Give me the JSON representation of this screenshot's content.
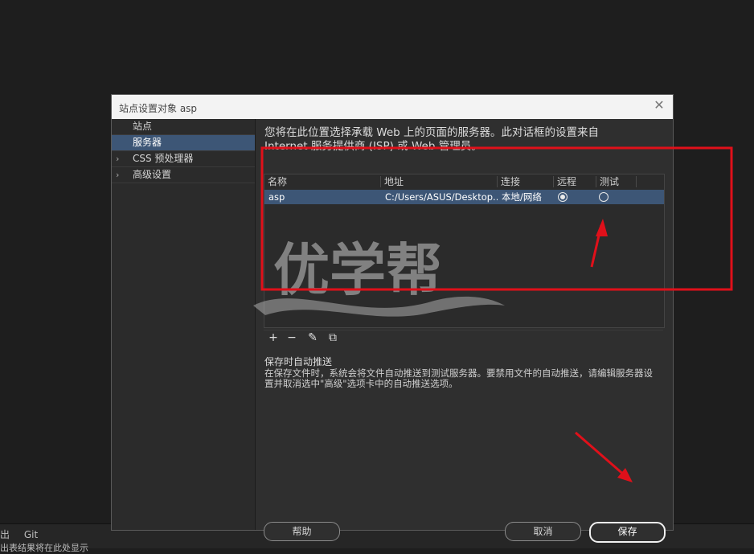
{
  "dialog": {
    "title": "站点设置对象 asp",
    "close_icon": "close-icon"
  },
  "sidebar": {
    "items": [
      {
        "label": "站点",
        "expandable": false,
        "selected": false
      },
      {
        "label": "服务器",
        "expandable": false,
        "selected": true
      },
      {
        "label": "CSS 预处理器",
        "expandable": true,
        "selected": false
      },
      {
        "label": "高级设置",
        "expandable": true,
        "selected": false
      }
    ]
  },
  "main": {
    "description": "您将在此位置选择承载 Web 上的页面的服务器。此对话框的设置来自 Internet 服务提供商 (ISP) 或 Web 管理员。",
    "table": {
      "headers": [
        "名称",
        "地址",
        "连接",
        "远程",
        "测试"
      ],
      "rows": [
        {
          "name": "asp",
          "address": "C:/Users/ASUS/Desktop...",
          "connection": "本地/网络",
          "remote": true,
          "test": false
        }
      ]
    },
    "toolbar": {
      "add": "+",
      "remove": "−",
      "edit": "✎",
      "duplicate": "⧉"
    },
    "autopush": {
      "title": "保存时自动推送",
      "text": "在保存文件时，系统会将文件自动推送到测试服务器。要禁用文件的自动推送，请编辑服务器设置并取消选中\"高级\"选项卡中的自动推送选项。"
    }
  },
  "buttons": {
    "help": "帮助",
    "cancel": "取消",
    "save": "保存"
  },
  "bottom": {
    "tabs": [
      "出",
      "Git"
    ],
    "status": "出表结果将在此处显示"
  },
  "watermark": {
    "text": "优学帮"
  },
  "colors": {
    "selection": "#3d5676",
    "annotation": "#e0101a"
  }
}
